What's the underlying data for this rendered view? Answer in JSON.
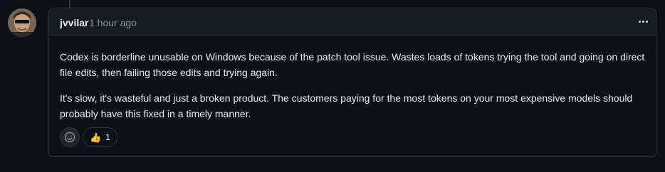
{
  "comment": {
    "author": "jvvilar",
    "timestamp": "1 hour ago",
    "paragraphs": [
      "Codex is borderline unusable on Windows because of the patch tool issue. Wastes loads of tokens trying the tool and going on direct file edits, then failing those edits and trying again.",
      "It's slow, it's wasteful and just a broken product. The customers paying for the most tokens on your most expensive models should probably have this fixed in a timely manner."
    ],
    "menu_icon": "kebab-horizontal-icon"
  },
  "reactions": {
    "add_icon": "smiley-icon",
    "items": [
      {
        "emoji": "👍",
        "count": "1"
      }
    ]
  },
  "colors": {
    "background": "#0d1117",
    "border": "#30363d",
    "header_bg": "#151b23",
    "muted_text": "#8b949e"
  }
}
